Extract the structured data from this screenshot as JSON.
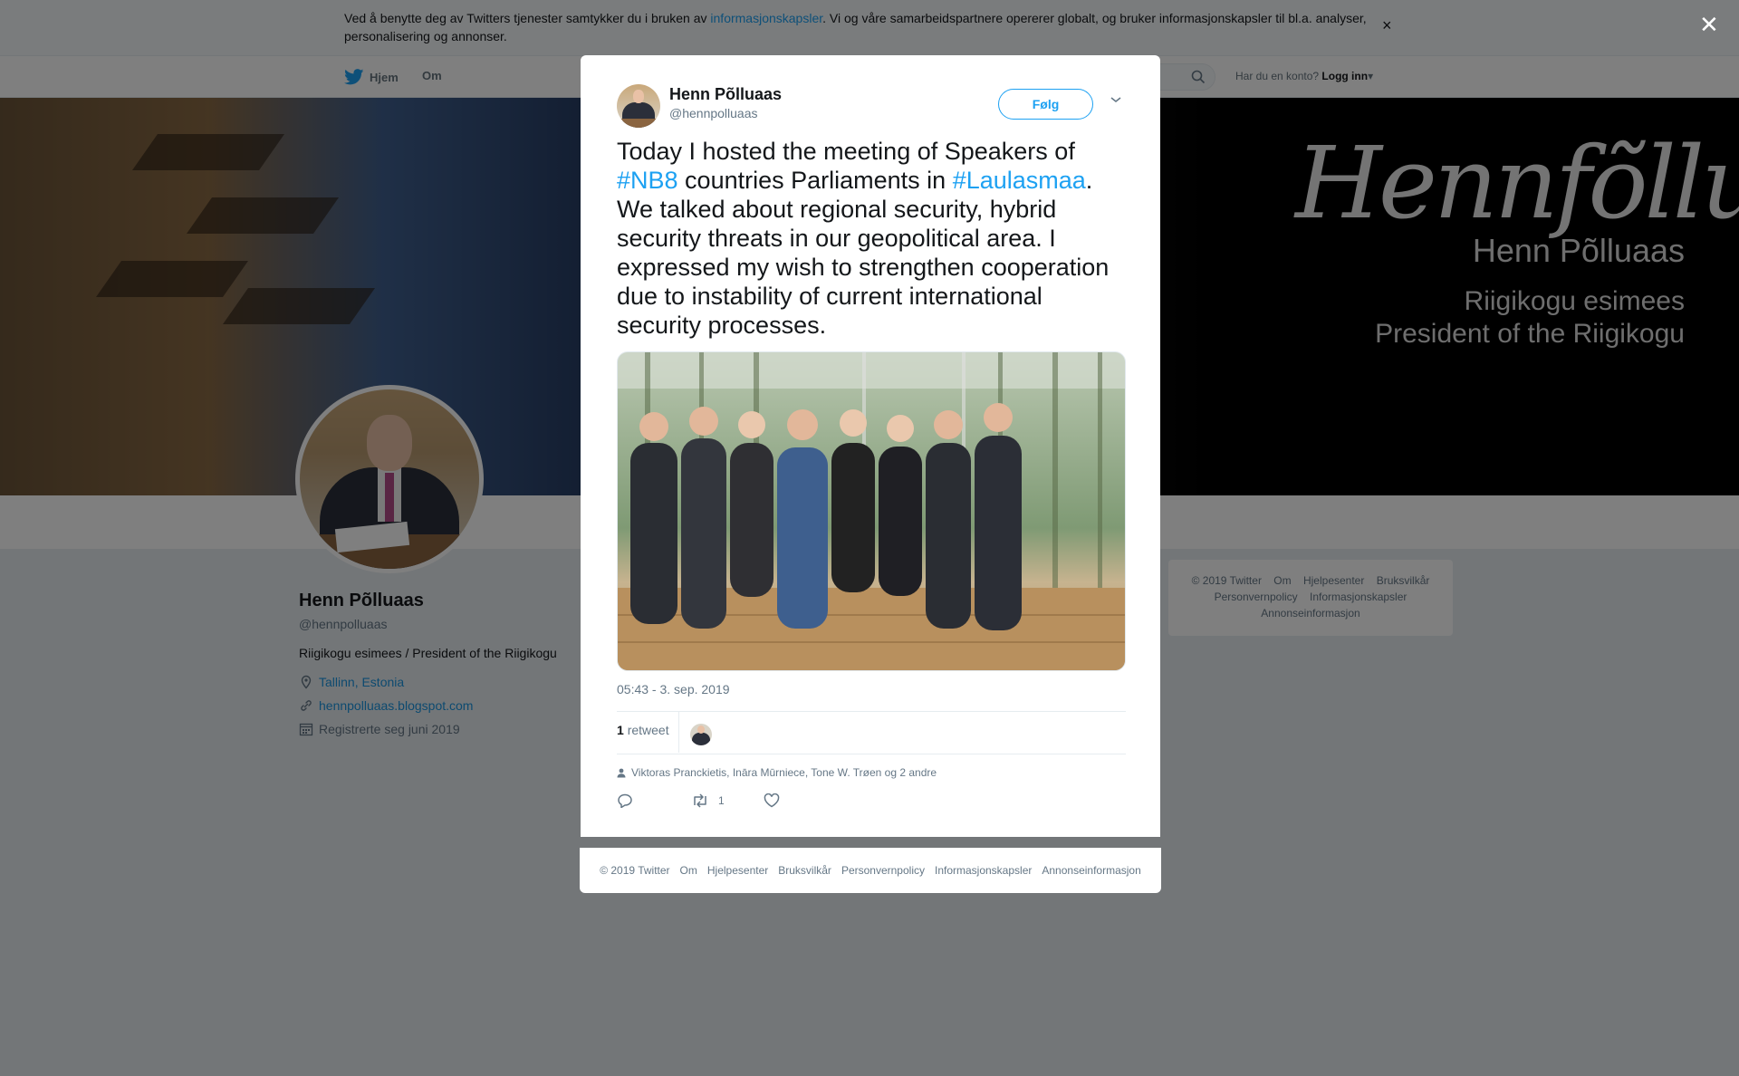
{
  "cookie": {
    "text_before": "Ved å benytte deg av Twitters tjenester samtykker du i bruken av ",
    "link": "informasjonskapsler",
    "text_after": ". Vi og våre samarbeidspartnere opererer globalt, og bruker informasjonskapsler til bl.a. analyser, personalisering og annonser."
  },
  "nav": {
    "home": "Hjem",
    "about": "Om",
    "login_prompt": "Har du en konto?",
    "login": "Logg inn"
  },
  "banner": {
    "signature": "Hennfõlluaas",
    "name": "Henn Põlluaas",
    "subtitle1": "Riigikogu esimees",
    "subtitle2": "President of the Riigikogu"
  },
  "profile": {
    "name": "Henn Põlluaas",
    "handle": "@hennpolluaas",
    "bio": "Riigikogu esimees / President of the Riigikogu",
    "location": "Tallinn, Estonia",
    "website": "hennpolluaas.blogspot.com",
    "joined": "Registrerte seg juni 2019"
  },
  "side_footer": {
    "items": [
      "© 2019 Twitter",
      "Om",
      "Hjelpesenter",
      "Bruksvilkår",
      "Personvernpolicy",
      "Informasjonskapsler",
      "Annonseinformasjon"
    ]
  },
  "tweet": {
    "author_name": "Henn Põlluaas",
    "author_handle": "@hennpolluaas",
    "follow_label": "Følg",
    "text_1": "Today I hosted the meeting of Speakers of ",
    "tag_1": "#NB8",
    "text_2": " countries Parliaments in ",
    "tag_2": "#Laulasmaa",
    "text_3": ". We talked about regional security, hybrid security threats in our geopolitical area. I expressed my wish to strengthen cooperation due to instability of current international security processes.",
    "timestamp": "05:43 - 3. sep. 2019",
    "retweet_count": "1",
    "retweet_label": "retweet",
    "tagged_people": "Viktoras Pranckietis, Ināra Mūrniece, Tone W. Trøen og 2 andre",
    "action_retweet_count": "1"
  },
  "modal_footer": {
    "items": [
      "© 2019 Twitter",
      "Om",
      "Hjelpesenter",
      "Bruksvilkår",
      "Personvernpolicy",
      "Informasjonskapsler",
      "Annonseinformasjon"
    ]
  },
  "icons": {
    "twitter_bird": "twitter-bird-icon",
    "search": "search-icon",
    "location": "location-pin-icon",
    "link": "link-icon",
    "calendar": "calendar-icon",
    "person": "person-icon",
    "reply": "reply-icon",
    "retweet": "retweet-icon",
    "like": "heart-icon",
    "close": "close-icon",
    "caret": "chevron-down-icon"
  },
  "colors": {
    "accent": "#1da1f2",
    "text": "#14171a",
    "secondary": "#657786",
    "background": "#e6ecf0"
  }
}
